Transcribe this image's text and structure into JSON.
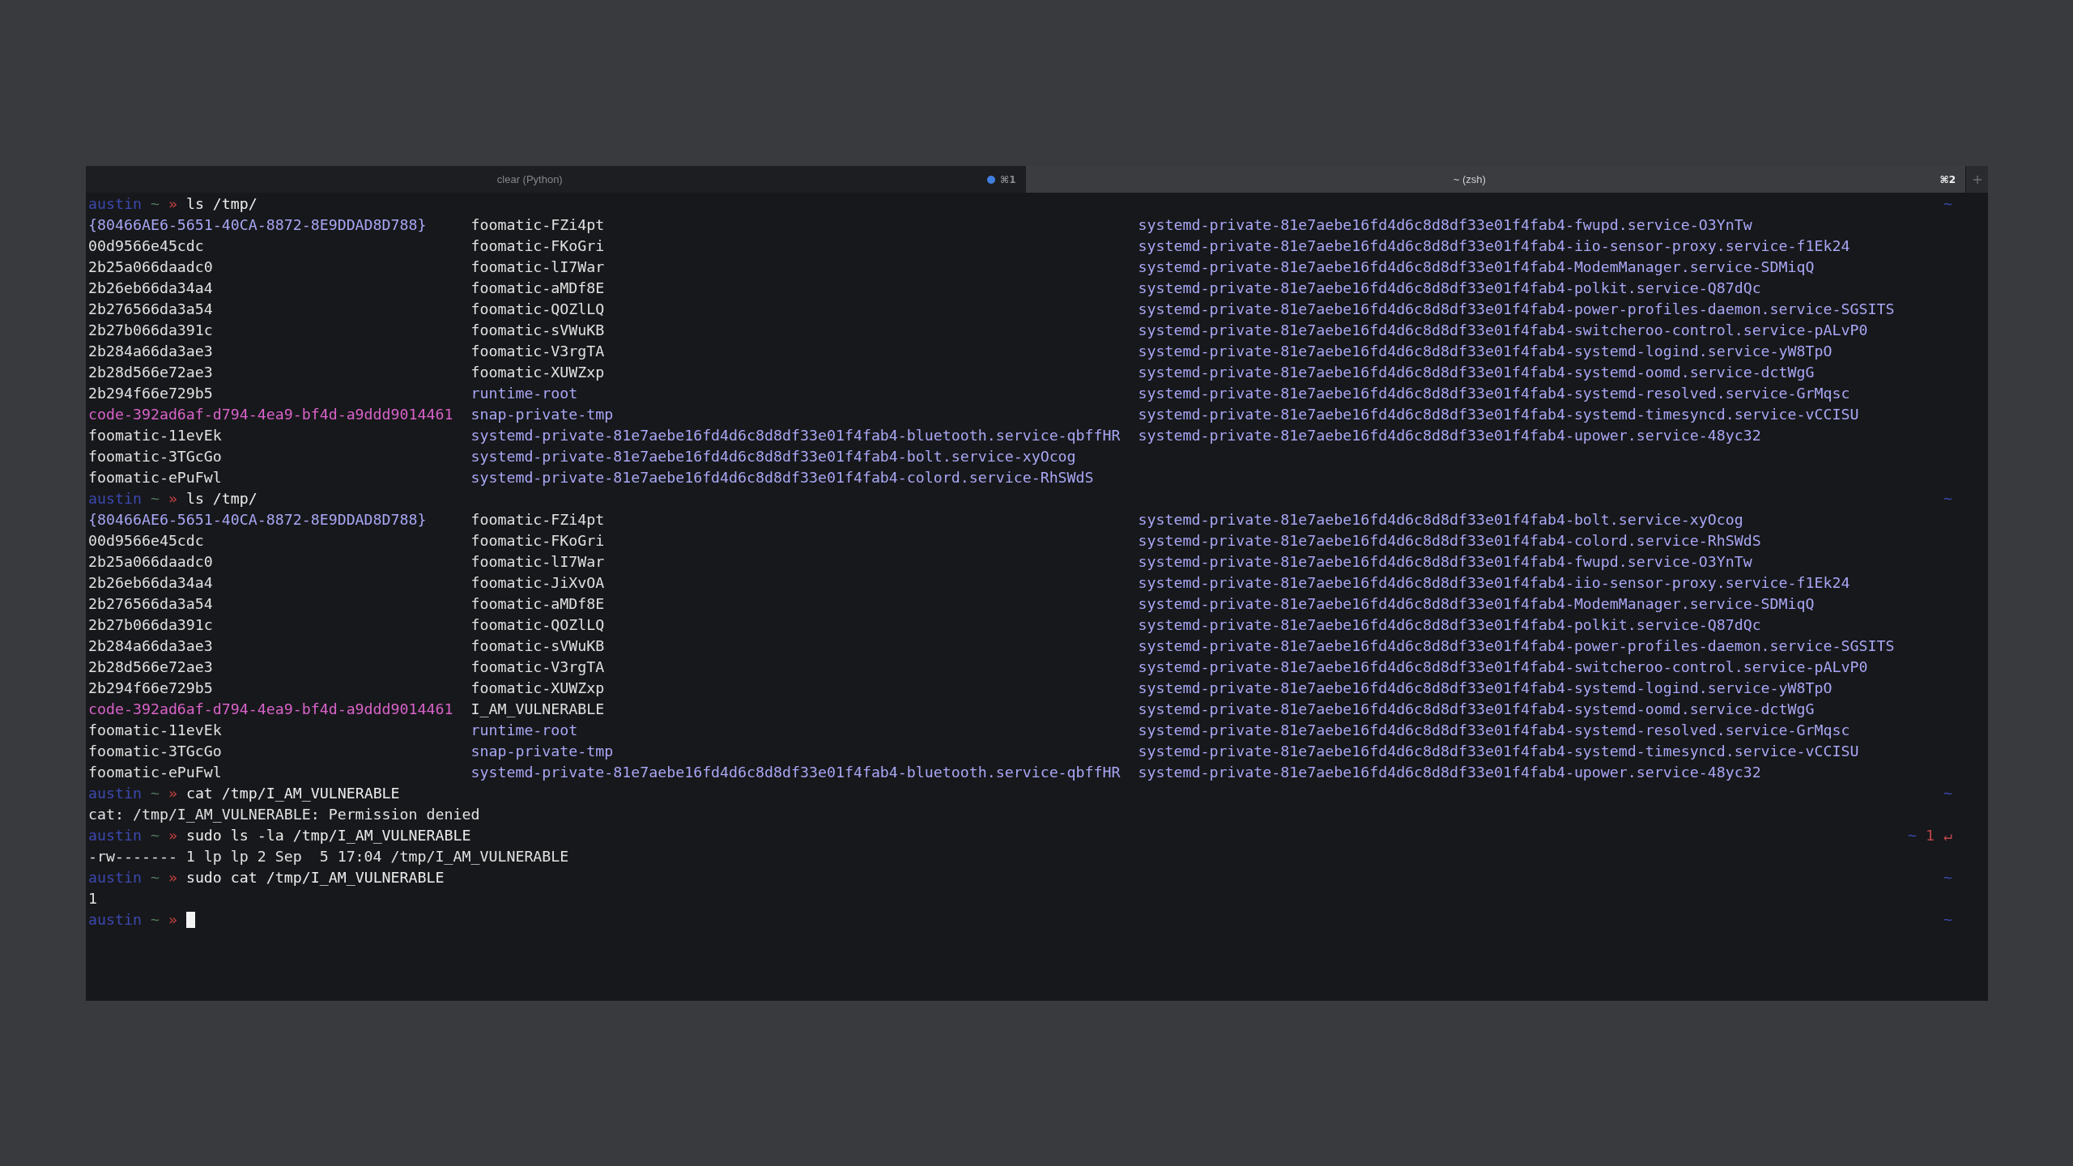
{
  "window": {
    "tabs": [
      {
        "title": "clear (Python)",
        "shortcut": "⌘1",
        "activity": true,
        "selected": false
      },
      {
        "title": "~ (zsh)",
        "shortcut": "⌘2",
        "activity": false,
        "selected": true
      }
    ]
  },
  "terminal": {
    "lines": [
      {
        "kind": "prompt",
        "user": "austin",
        "path": "~",
        "symbol": "»",
        "command": "ls /tmp/",
        "rprompt": "~",
        "cursor": false
      },
      {
        "kind": "listing",
        "columns": [
          [
            {
              "name": "{80466AE6-5651-40CA-8872-8E9DDAD8D788}",
              "kind": "dir"
            },
            {
              "name": "00d9566e45cdc",
              "kind": "file"
            },
            {
              "name": "2b25a066daadc0",
              "kind": "file"
            },
            {
              "name": "2b26eb66da34a4",
              "kind": "file"
            },
            {
              "name": "2b276566da3a54",
              "kind": "file"
            },
            {
              "name": "2b27b066da391c",
              "kind": "file"
            },
            {
              "name": "2b284a66da3ae3",
              "kind": "file"
            },
            {
              "name": "2b28d566e72ae3",
              "kind": "file"
            },
            {
              "name": "2b294f66e729b5",
              "kind": "file"
            },
            {
              "name": "code-392ad6af-d794-4ea9-bf4d-a9ddd9014461",
              "kind": "socket"
            },
            {
              "name": "foomatic-11evEk",
              "kind": "file"
            },
            {
              "name": "foomatic-3TGcGo",
              "kind": "file"
            },
            {
              "name": "foomatic-ePuFwl",
              "kind": "file"
            }
          ],
          [
            {
              "name": "foomatic-FZi4pt",
              "kind": "file"
            },
            {
              "name": "foomatic-FKoGri",
              "kind": "file"
            },
            {
              "name": "foomatic-lI7War",
              "kind": "file"
            },
            {
              "name": "foomatic-aMDf8E",
              "kind": "file"
            },
            {
              "name": "foomatic-QOZlLQ",
              "kind": "file"
            },
            {
              "name": "foomatic-sVWuKB",
              "kind": "file"
            },
            {
              "name": "foomatic-V3rgTA",
              "kind": "file"
            },
            {
              "name": "foomatic-XUWZxp",
              "kind": "file"
            },
            {
              "name": "runtime-root",
              "kind": "dir"
            },
            {
              "name": "snap-private-tmp",
              "kind": "dir"
            },
            {
              "name": "systemd-private-81e7aebe16fd4d6c8d8df33e01f4fab4-bluetooth.service-qbffHR",
              "kind": "dir"
            },
            {
              "name": "systemd-private-81e7aebe16fd4d6c8d8df33e01f4fab4-bolt.service-xyOcog",
              "kind": "dir"
            },
            {
              "name": "systemd-private-81e7aebe16fd4d6c8d8df33e01f4fab4-colord.service-RhSWdS",
              "kind": "dir"
            }
          ],
          [
            {
              "name": "systemd-private-81e7aebe16fd4d6c8d8df33e01f4fab4-fwupd.service-O3YnTw",
              "kind": "dir"
            },
            {
              "name": "systemd-private-81e7aebe16fd4d6c8d8df33e01f4fab4-iio-sensor-proxy.service-f1Ek24",
              "kind": "dir"
            },
            {
              "name": "systemd-private-81e7aebe16fd4d6c8d8df33e01f4fab4-ModemManager.service-SDMiqQ",
              "kind": "dir"
            },
            {
              "name": "systemd-private-81e7aebe16fd4d6c8d8df33e01f4fab4-polkit.service-Q87dQc",
              "kind": "dir"
            },
            {
              "name": "systemd-private-81e7aebe16fd4d6c8d8df33e01f4fab4-power-profiles-daemon.service-SGSITS",
              "kind": "dir"
            },
            {
              "name": "systemd-private-81e7aebe16fd4d6c8d8df33e01f4fab4-switcheroo-control.service-pALvP0",
              "kind": "dir"
            },
            {
              "name": "systemd-private-81e7aebe16fd4d6c8d8df33e01f4fab4-systemd-logind.service-yW8TpO",
              "kind": "dir"
            },
            {
              "name": "systemd-private-81e7aebe16fd4d6c8d8df33e01f4fab4-systemd-oomd.service-dctWgG",
              "kind": "dir"
            },
            {
              "name": "systemd-private-81e7aebe16fd4d6c8d8df33e01f4fab4-systemd-resolved.service-GrMqsc",
              "kind": "dir"
            },
            {
              "name": "systemd-private-81e7aebe16fd4d6c8d8df33e01f4fab4-systemd-timesyncd.service-vCCISU",
              "kind": "dir"
            },
            {
              "name": "systemd-private-81e7aebe16fd4d6c8d8df33e01f4fab4-upower.service-48yc32",
              "kind": "dir"
            }
          ]
        ]
      },
      {
        "kind": "prompt",
        "user": "austin",
        "path": "~",
        "symbol": "»",
        "command": "ls /tmp/",
        "rprompt": "~",
        "cursor": false
      },
      {
        "kind": "listing",
        "columns": [
          [
            {
              "name": "{80466AE6-5651-40CA-8872-8E9DDAD8D788}",
              "kind": "dir"
            },
            {
              "name": "00d9566e45cdc",
              "kind": "file"
            },
            {
              "name": "2b25a066daadc0",
              "kind": "file"
            },
            {
              "name": "2b26eb66da34a4",
              "kind": "file"
            },
            {
              "name": "2b276566da3a54",
              "kind": "file"
            },
            {
              "name": "2b27b066da391c",
              "kind": "file"
            },
            {
              "name": "2b284a66da3ae3",
              "kind": "file"
            },
            {
              "name": "2b28d566e72ae3",
              "kind": "file"
            },
            {
              "name": "2b294f66e729b5",
              "kind": "file"
            },
            {
              "name": "code-392ad6af-d794-4ea9-bf4d-a9ddd9014461",
              "kind": "socket"
            },
            {
              "name": "foomatic-11evEk",
              "kind": "file"
            },
            {
              "name": "foomatic-3TGcGo",
              "kind": "file"
            },
            {
              "name": "foomatic-ePuFwl",
              "kind": "file"
            }
          ],
          [
            {
              "name": "foomatic-FZi4pt",
              "kind": "file"
            },
            {
              "name": "foomatic-FKoGri",
              "kind": "file"
            },
            {
              "name": "foomatic-lI7War",
              "kind": "file"
            },
            {
              "name": "foomatic-JiXvOA",
              "kind": "file"
            },
            {
              "name": "foomatic-aMDf8E",
              "kind": "file"
            },
            {
              "name": "foomatic-QOZlLQ",
              "kind": "file"
            },
            {
              "name": "foomatic-sVWuKB",
              "kind": "file"
            },
            {
              "name": "foomatic-V3rgTA",
              "kind": "file"
            },
            {
              "name": "foomatic-XUWZxp",
              "kind": "file"
            },
            {
              "name": "I_AM_VULNERABLE",
              "kind": "file"
            },
            {
              "name": "runtime-root",
              "kind": "dir"
            },
            {
              "name": "snap-private-tmp",
              "kind": "dir"
            },
            {
              "name": "systemd-private-81e7aebe16fd4d6c8d8df33e01f4fab4-bluetooth.service-qbffHR",
              "kind": "dir"
            }
          ],
          [
            {
              "name": "systemd-private-81e7aebe16fd4d6c8d8df33e01f4fab4-bolt.service-xyOcog",
              "kind": "dir"
            },
            {
              "name": "systemd-private-81e7aebe16fd4d6c8d8df33e01f4fab4-colord.service-RhSWdS",
              "kind": "dir"
            },
            {
              "name": "systemd-private-81e7aebe16fd4d6c8d8df33e01f4fab4-fwupd.service-O3YnTw",
              "kind": "dir"
            },
            {
              "name": "systemd-private-81e7aebe16fd4d6c8d8df33e01f4fab4-iio-sensor-proxy.service-f1Ek24",
              "kind": "dir"
            },
            {
              "name": "systemd-private-81e7aebe16fd4d6c8d8df33e01f4fab4-ModemManager.service-SDMiqQ",
              "kind": "dir"
            },
            {
              "name": "systemd-private-81e7aebe16fd4d6c8d8df33e01f4fab4-polkit.service-Q87dQc",
              "kind": "dir"
            },
            {
              "name": "systemd-private-81e7aebe16fd4d6c8d8df33e01f4fab4-power-profiles-daemon.service-SGSITS",
              "kind": "dir"
            },
            {
              "name": "systemd-private-81e7aebe16fd4d6c8d8df33e01f4fab4-switcheroo-control.service-pALvP0",
              "kind": "dir"
            },
            {
              "name": "systemd-private-81e7aebe16fd4d6c8d8df33e01f4fab4-systemd-logind.service-yW8TpO",
              "kind": "dir"
            },
            {
              "name": "systemd-private-81e7aebe16fd4d6c8d8df33e01f4fab4-systemd-oomd.service-dctWgG",
              "kind": "dir"
            },
            {
              "name": "systemd-private-81e7aebe16fd4d6c8d8df33e01f4fab4-systemd-resolved.service-GrMqsc",
              "kind": "dir"
            },
            {
              "name": "systemd-private-81e7aebe16fd4d6c8d8df33e01f4fab4-systemd-timesyncd.service-vCCISU",
              "kind": "dir"
            },
            {
              "name": "systemd-private-81e7aebe16fd4d6c8d8df33e01f4fab4-upower.service-48yc32",
              "kind": "dir"
            }
          ]
        ]
      },
      {
        "kind": "prompt",
        "user": "austin",
        "path": "~",
        "symbol": "»",
        "command": "cat /tmp/I_AM_VULNERABLE",
        "rprompt": "~",
        "cursor": false
      },
      {
        "kind": "output",
        "text": "cat: /tmp/I_AM_VULNERABLE: Permission denied"
      },
      {
        "kind": "prompt",
        "user": "austin",
        "path": "~",
        "symbol": "»",
        "command": "sudo ls -la /tmp/I_AM_VULNERABLE",
        "rprompt": "~",
        "exit_status": "1 ↵",
        "cursor": false
      },
      {
        "kind": "output",
        "text": "-rw------- 1 lp lp 2 Sep  5 17:04 /tmp/I_AM_VULNERABLE"
      },
      {
        "kind": "prompt",
        "user": "austin",
        "path": "~",
        "symbol": "»",
        "command": "sudo cat /tmp/I_AM_VULNERABLE",
        "rprompt": "~",
        "cursor": false
      },
      {
        "kind": "output",
        "text": "1"
      },
      {
        "kind": "prompt",
        "user": "austin",
        "path": "~",
        "symbol": "»",
        "rprompt": "~",
        "cursor": true
      }
    ]
  }
}
